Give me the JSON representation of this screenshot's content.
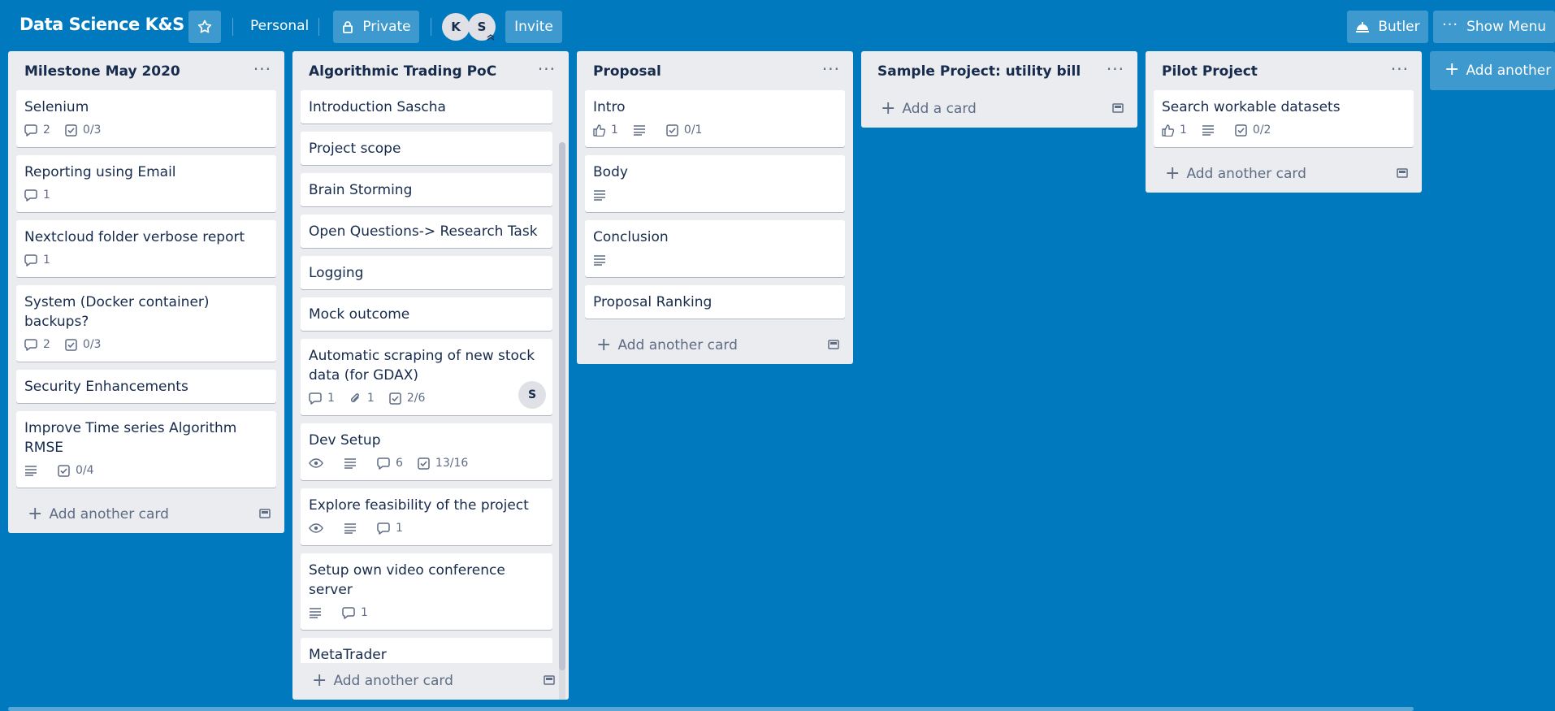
{
  "header": {
    "board_title": "Data Science K&S",
    "star_icon": "star-icon",
    "team_label": "Personal",
    "visibility_label": "Private",
    "members": [
      "K",
      "S"
    ],
    "invite_label": "Invite",
    "butler_label": "Butler",
    "show_menu_label": "Show Menu"
  },
  "lists": [
    {
      "title": "Milestone May 2020",
      "cards": [
        {
          "title": "Selenium",
          "comments": "2",
          "checklist": "0/3"
        },
        {
          "title": "Reporting using Email",
          "comments": "1"
        },
        {
          "title": "Nextcloud folder verbose report",
          "comments": "1"
        },
        {
          "title": "System (Docker container) backups?",
          "comments": "2",
          "checklist": "0/3"
        },
        {
          "title": "Security Enhancements"
        },
        {
          "title": "Improve Time series Algorithm RMSE",
          "checklist": "0/4"
        }
      ],
      "add_label": "Add another card"
    },
    {
      "title": "Algorithmic Trading PoC",
      "cards": [
        {
          "title": "Introduction Sascha"
        },
        {
          "title": "Project scope"
        },
        {
          "title": "Brain Storming"
        },
        {
          "title": "Open Questions-> Research Task"
        },
        {
          "title": "Logging"
        },
        {
          "title": "Mock outcome"
        },
        {
          "title": "Automatic scraping of new stock data (for GDAX)",
          "comments": "1",
          "attachments": "1",
          "checklist": "2/6",
          "member": "S"
        },
        {
          "title": "Dev Setup",
          "comments": "6",
          "checklist": "13/16"
        },
        {
          "title": "Explore feasibility of the project",
          "comments": "1"
        },
        {
          "title": "Setup own video conference server",
          "comments": "1"
        },
        {
          "title": "MetaTrader"
        }
      ],
      "add_label": "Add another card"
    },
    {
      "title": "Proposal",
      "cards": [
        {
          "title": "Intro",
          "votes": "1",
          "checklist": "0/1"
        },
        {
          "title": "Body"
        },
        {
          "title": "Conclusion"
        },
        {
          "title": "Proposal Ranking"
        }
      ],
      "add_label": "Add another card"
    },
    {
      "title": "Sample Project: utility bill",
      "cards": [],
      "add_label": "Add a card"
    },
    {
      "title": "Pilot Project",
      "cards": [
        {
          "title": "Search workable datasets",
          "votes": "1",
          "checklist": "0/2"
        }
      ],
      "add_label": "Add another card"
    }
  ],
  "add_list_label": "Add another list",
  "colors": {
    "board_bg": "#0079bf",
    "list_bg": "#ebecf0"
  }
}
